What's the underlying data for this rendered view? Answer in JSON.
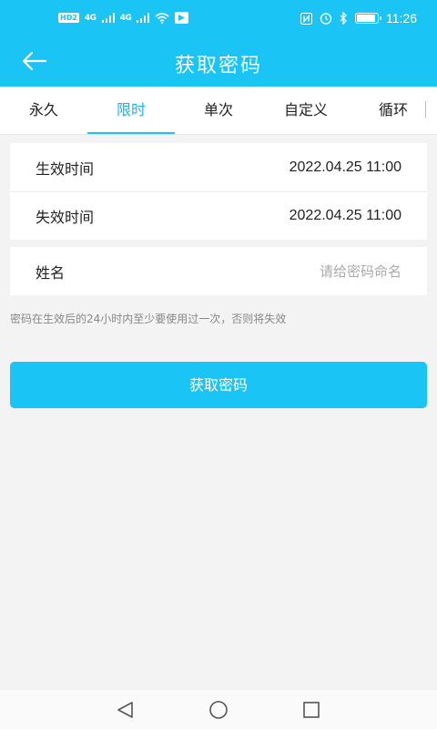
{
  "status_bar": {
    "badge": "HD",
    "badge_sub": "2",
    "network_1": "4G",
    "network_2": "4G",
    "time": "11:26",
    "battery_level": 0.9
  },
  "header": {
    "title": "获取密码",
    "accent_color": "#1ac4f5"
  },
  "tabs": [
    {
      "label": "永久",
      "active": false
    },
    {
      "label": "限时",
      "active": true
    },
    {
      "label": "单次",
      "active": false
    },
    {
      "label": "自定义",
      "active": false
    },
    {
      "label": "循环",
      "active": false
    }
  ],
  "form": {
    "start_label": "生效时间",
    "start_value": "2022.04.25 11:00",
    "end_label": "失效时间",
    "end_value": "2022.04.25 11:00",
    "name_label": "姓名",
    "name_value": "",
    "name_placeholder": "请给密码命名"
  },
  "hint": "密码在生效后的24小时内至少要使用过一次，否则将失效",
  "submit_label": "获取密码",
  "icons": {
    "back": "arrow-left-icon",
    "nav_back": "triangle-back-icon",
    "nav_home": "circle-home-icon",
    "nav_recent": "square-recent-icon"
  }
}
